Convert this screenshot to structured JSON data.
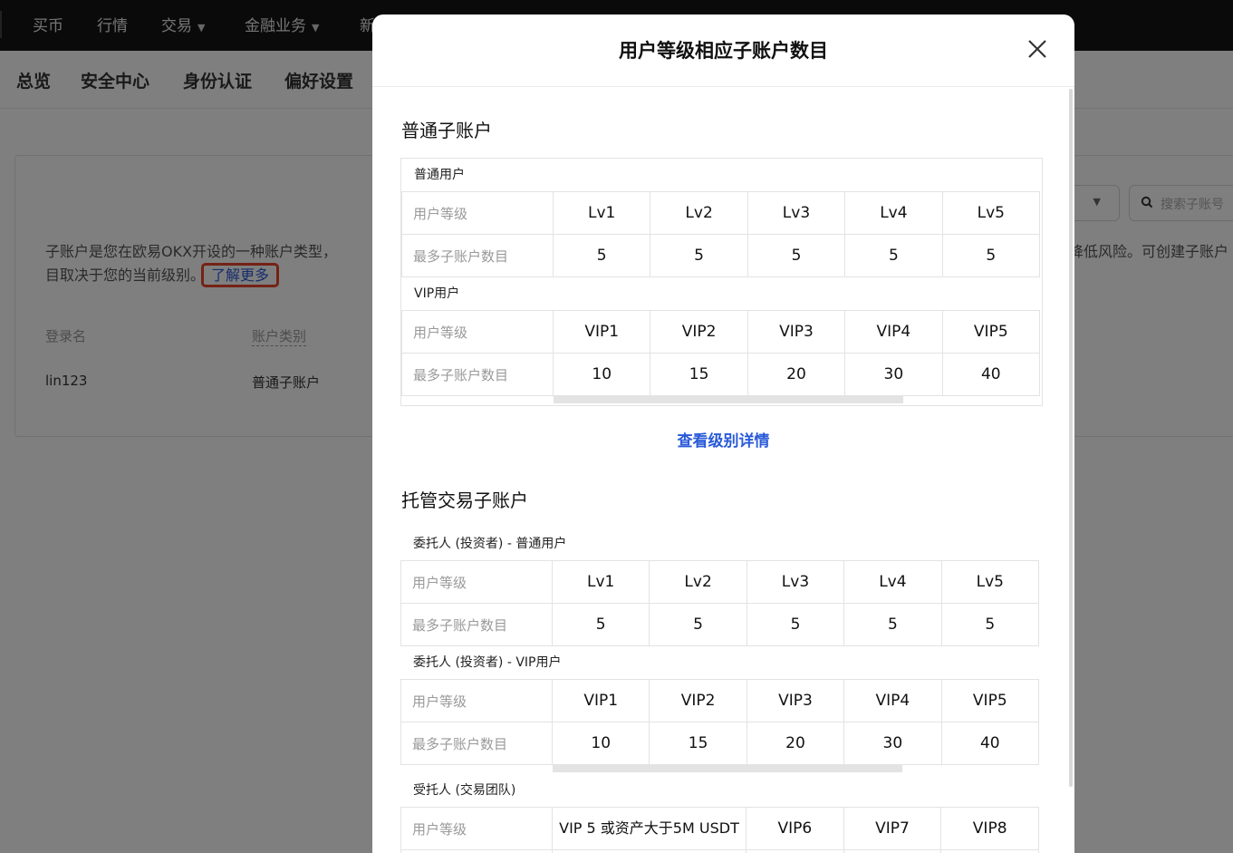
{
  "topnav": {
    "items": [
      "买币",
      "行情",
      "交易",
      "金融业务",
      "新"
    ],
    "has_dropdown": [
      false,
      false,
      true,
      true,
      false
    ]
  },
  "subnav": {
    "items": [
      "总览",
      "安全中心",
      "身份认证",
      "偏好设置"
    ]
  },
  "page": {
    "intro_text": "子账户是您在欧易OKX开设的一种账户类型，",
    "intro_text_2": "目取决于您的当前级别。",
    "intro_right": "降低风险。可创建子账户",
    "learn_more": "了解更多",
    "columns": [
      "登录名",
      "账户类别"
    ],
    "row": {
      "login_name": "lin123",
      "account_type": "普通子账户"
    },
    "search_placeholder": "搜索子账号"
  },
  "modal": {
    "title": "用户等级相应子账户数目",
    "sections": {
      "normal": {
        "title": "普通子账户",
        "groups": [
          {
            "label": "普通用户",
            "row_labels": [
              "用户等级",
              "最多子账户数目"
            ],
            "levels": [
              "Lv1",
              "Lv2",
              "Lv3",
              "Lv4",
              "Lv5"
            ],
            "counts": [
              "5",
              "5",
              "5",
              "5",
              "5"
            ]
          },
          {
            "label": "VIP用户",
            "row_labels": [
              "用户等级",
              "最多子账户数目"
            ],
            "levels": [
              "VIP1",
              "VIP2",
              "VIP3",
              "VIP4",
              "VIP5"
            ],
            "counts": [
              "10",
              "15",
              "20",
              "30",
              "40"
            ]
          }
        ]
      },
      "details_link": "查看级别详情",
      "managed": {
        "title": "托管交易子账户",
        "groups": [
          {
            "label": "委托人 (投资者) - 普通用户",
            "row_labels": [
              "用户等级",
              "最多子账户数目"
            ],
            "levels": [
              "Lv1",
              "Lv2",
              "Lv3",
              "Lv4",
              "Lv5"
            ],
            "counts": [
              "5",
              "5",
              "5",
              "5",
              "5"
            ]
          },
          {
            "label": "委托人 (投资者) - VIP用户",
            "row_labels": [
              "用户等级",
              "最多子账户数目"
            ],
            "levels": [
              "VIP1",
              "VIP2",
              "VIP3",
              "VIP4",
              "VIP5"
            ],
            "counts": [
              "10",
              "15",
              "20",
              "30",
              "40"
            ]
          },
          {
            "label": "受托人 (交易团队)",
            "row_labels": [
              "用户等级"
            ],
            "levels": [
              "VIP 5 或资产大于5M USDT",
              "VIP6",
              "VIP7",
              "VIP8"
            ]
          }
        ]
      }
    }
  }
}
